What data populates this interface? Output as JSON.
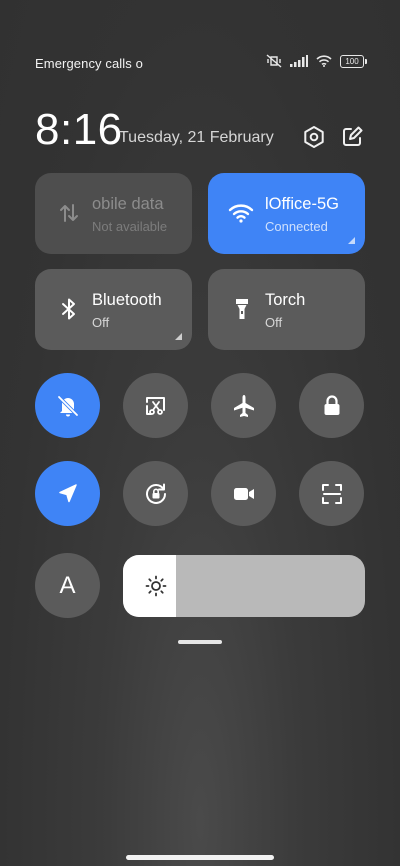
{
  "status_bar": {
    "text": "Emergency calls o",
    "battery": "100",
    "icons": [
      "mute-vibrate-icon",
      "signal-icon",
      "wifi-icon",
      "battery-icon"
    ]
  },
  "header": {
    "time": "8:16",
    "date": "Tuesday, 21 February",
    "icons": [
      "settings-icon",
      "edit-icon"
    ]
  },
  "tiles": [
    {
      "title": "obile data",
      "subtitle": "Not available",
      "icon": "mobile-data-icon",
      "state": "disabled"
    },
    {
      "title": "lOffice-5G",
      "subtitle": "Connected",
      "icon": "wifi-icon",
      "state": "on"
    },
    {
      "title": "Bluetooth",
      "subtitle": "Off",
      "icon": "bluetooth-icon",
      "state": "off"
    },
    {
      "title": "Torch",
      "subtitle": "Off",
      "icon": "torch-icon",
      "state": "off"
    }
  ],
  "toggles_row1": [
    {
      "icon": "mute-bell-icon",
      "state": "on"
    },
    {
      "icon": "screenshot-icon",
      "state": "off"
    },
    {
      "icon": "airplane-icon",
      "state": "off"
    },
    {
      "icon": "lock-icon",
      "state": "off"
    }
  ],
  "toggles_row2": [
    {
      "icon": "location-icon",
      "state": "on"
    },
    {
      "icon": "rotation-lock-icon",
      "state": "off"
    },
    {
      "icon": "screen-record-icon",
      "state": "off"
    },
    {
      "icon": "scanner-icon",
      "state": "off"
    }
  ],
  "auto_brightness_label": "A",
  "brightness": {
    "level": 0.22,
    "icon": "sun-icon"
  },
  "colors": {
    "accent": "#3f84f6",
    "tile": "#5b5b5b",
    "background": "#333333"
  }
}
